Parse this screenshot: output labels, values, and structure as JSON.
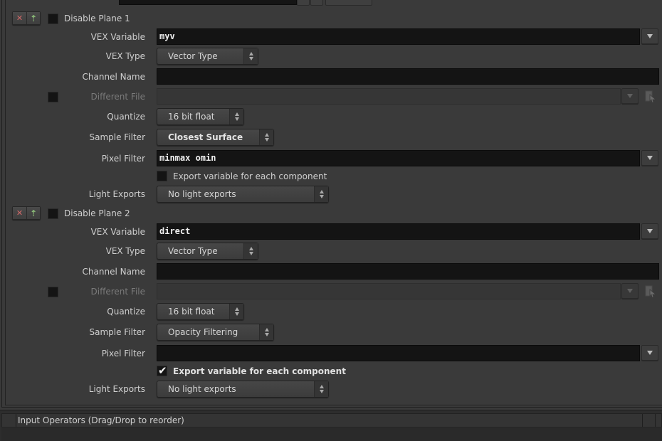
{
  "planes": [
    {
      "disable_label": "Disable Plane 1",
      "disabled": false,
      "vex_variable_label": "VEX Variable",
      "vex_variable": "myv",
      "vex_type_label": "VEX Type",
      "vex_type": "Vector Type",
      "channel_name_label": "Channel Name",
      "channel_name": "",
      "different_file_label": "Different File",
      "different_file": "",
      "different_file_enabled": false,
      "quantize_label": "Quantize",
      "quantize": "16 bit float",
      "sample_filter_label": "Sample Filter",
      "sample_filter": "Closest Surface",
      "pixel_filter_label": "Pixel Filter",
      "pixel_filter": "minmax omin",
      "export_component_label": "Export variable for each component",
      "export_component": false,
      "light_exports_label": "Light Exports",
      "light_exports": "No light exports"
    },
    {
      "disable_label": "Disable Plane 2",
      "disabled": false,
      "vex_variable_label": "VEX Variable",
      "vex_variable": "direct",
      "vex_type_label": "VEX Type",
      "vex_type": "Vector Type",
      "channel_name_label": "Channel Name",
      "channel_name": "",
      "different_file_label": "Different File",
      "different_file": "",
      "different_file_enabled": false,
      "quantize_label": "Quantize",
      "quantize": "16 bit float",
      "sample_filter_label": "Sample Filter",
      "sample_filter": "Opacity Filtering",
      "pixel_filter_label": "Pixel Filter",
      "pixel_filter": "",
      "export_component_label": "Export variable for each component",
      "export_component": true,
      "light_exports_label": "Light Exports",
      "light_exports": "No light exports"
    }
  ],
  "icons": {
    "remove": "✕",
    "add": "⇡",
    "check": "✔"
  },
  "bottom_panel": {
    "title": "Input Operators (Drag/Drop to reorder)"
  },
  "colors": {
    "background": "#3a3a3a",
    "field_bg": "#141414",
    "remove_icon": "#d46a6a",
    "add_icon": "#8fc27a"
  }
}
